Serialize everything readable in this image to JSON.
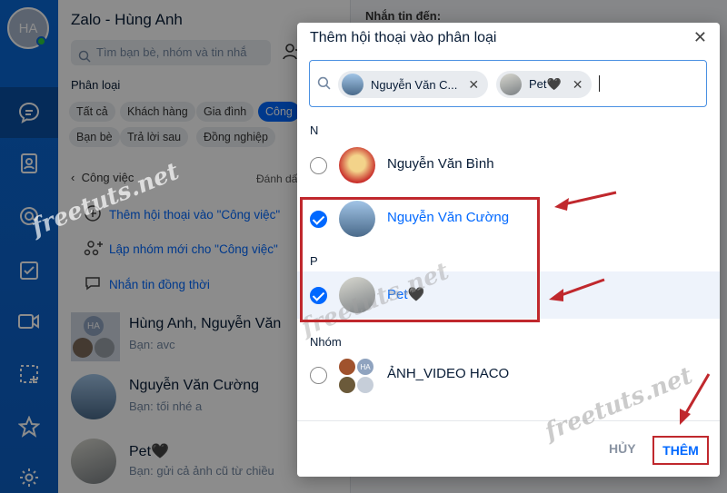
{
  "app": {
    "account_name": "Zalo - Hùng Anh",
    "avatar_initials": "HA",
    "search_placeholder": "Tìm bạn bè, nhóm và tin nhắ"
  },
  "sidebar": {
    "category_label": "Phân loại",
    "chips": [
      "Tất cả",
      "Khách hàng",
      "Gia đình",
      "Công",
      "Bạn bè",
      "Trả lời sau",
      "Đồng nghiệp"
    ],
    "filter_label": "Công việc",
    "mark_read": "Đánh dấ",
    "actions": [
      {
        "label": "Thêm hội thoại vào \"Công việc\"",
        "icon": "add-conversation-icon"
      },
      {
        "label": "Lập nhóm mới cho \"Công việc\"",
        "icon": "create-group-icon"
      },
      {
        "label": "Nhắn tin đồng thời",
        "icon": "broadcast-message-icon"
      }
    ],
    "conversations": [
      {
        "name": "Hùng Anh, Nguyễn Văn",
        "message": "Bạn: avc",
        "avatar_initials": "HA"
      },
      {
        "name": "Nguyễn Văn Cường",
        "message": "Bạn: tối nhé a"
      },
      {
        "name": "Pet🖤",
        "message": "Bạn: gửi cả ảnh cũ từ chiều"
      }
    ]
  },
  "chat": {
    "to_label": "Nhắn tin đến:"
  },
  "modal": {
    "title": "Thêm hội thoại vào phân loại",
    "selected_tags": [
      {
        "label": "Nguyễn Văn C..."
      },
      {
        "label": "Pet🖤"
      }
    ],
    "sections": [
      {
        "letter": "N",
        "rows": [
          {
            "name": "Nguyễn Văn Bình",
            "selected": false
          },
          {
            "name": "Nguyễn Văn Cường",
            "selected": true
          }
        ]
      },
      {
        "letter": "P",
        "rows": [
          {
            "name": "Pet🖤",
            "selected": true
          }
        ]
      },
      {
        "letter": "Nhóm",
        "rows": [
          {
            "name": "ẢNH_VIDEO HACO",
            "selected": false,
            "group_initials": "HA"
          }
        ]
      }
    ],
    "cancel_label": "HỦY",
    "add_label": "THÊM"
  },
  "watermark": "freetuts.net",
  "colors": {
    "accent": "#0068ff",
    "rail": "#0a68d6",
    "highlight": "#c0282d"
  }
}
